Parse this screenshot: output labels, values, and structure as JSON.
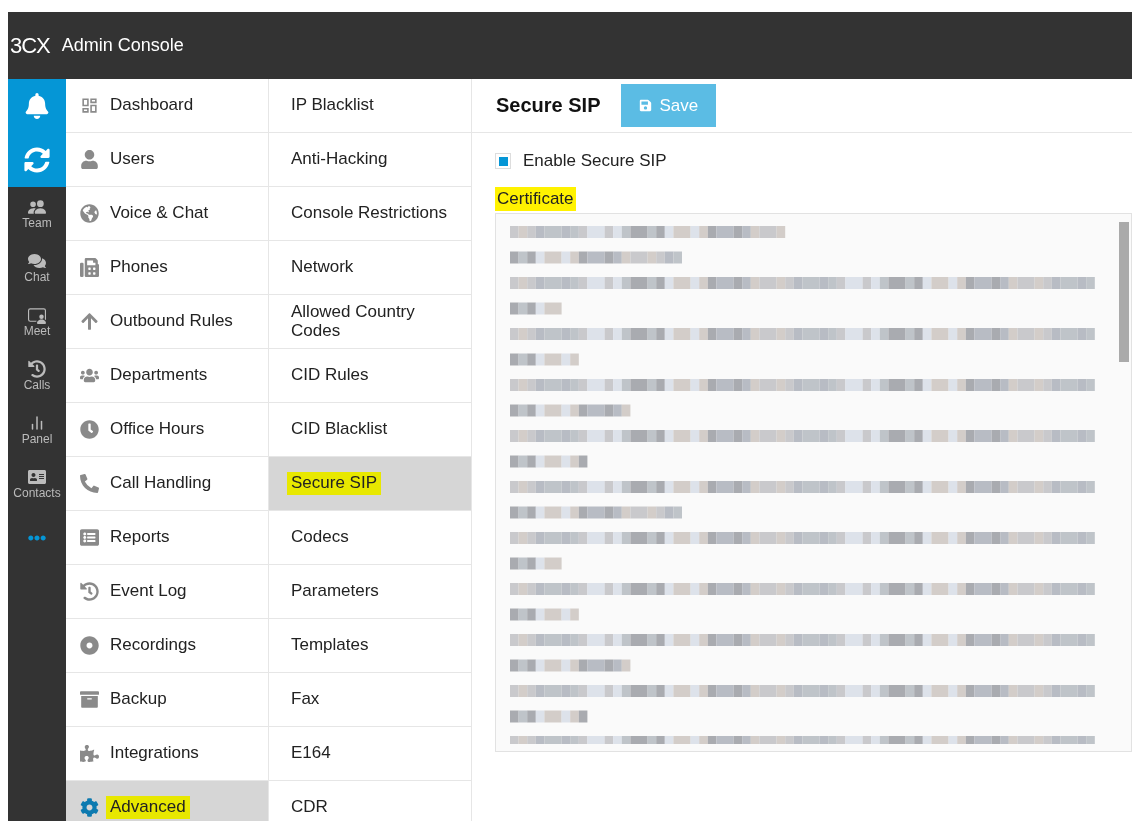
{
  "header": {
    "logo": "3CX",
    "title": "Admin Console"
  },
  "rail": [
    {
      "active": true
    },
    {
      "active": true
    },
    {
      "label": "Team",
      "active": false
    },
    {
      "label": "Chat",
      "active": false
    },
    {
      "label": "Meet",
      "active": false
    },
    {
      "label": "Calls",
      "active": false
    },
    {
      "label": "Panel",
      "active": false
    },
    {
      "label": "Contacts",
      "active": false
    },
    {
      "active": false
    }
  ],
  "nav": [
    {
      "label": "Dashboard",
      "selected": false,
      "highlighted": false
    },
    {
      "label": "Users",
      "selected": false,
      "highlighted": false
    },
    {
      "label": "Voice & Chat",
      "selected": false,
      "highlighted": false
    },
    {
      "label": "Phones",
      "selected": false,
      "highlighted": false
    },
    {
      "label": "Outbound Rules",
      "selected": false,
      "highlighted": false
    },
    {
      "label": "Departments",
      "selected": false,
      "highlighted": false
    },
    {
      "label": "Office Hours",
      "selected": false,
      "highlighted": false
    },
    {
      "label": "Call Handling",
      "selected": false,
      "highlighted": false
    },
    {
      "label": "Reports",
      "selected": false,
      "highlighted": false
    },
    {
      "label": "Event Log",
      "selected": false,
      "highlighted": false
    },
    {
      "label": "Recordings",
      "selected": false,
      "highlighted": false
    },
    {
      "label": "Backup",
      "selected": false,
      "highlighted": false
    },
    {
      "label": "Integrations",
      "selected": false,
      "highlighted": false
    },
    {
      "label": "Advanced",
      "selected": true,
      "highlighted": true
    }
  ],
  "submenu": [
    {
      "label": "IP Blacklist",
      "selected": false,
      "highlighted": false
    },
    {
      "label": "Anti-Hacking",
      "selected": false,
      "highlighted": false
    },
    {
      "label": "Console Restrictions",
      "selected": false,
      "highlighted": false
    },
    {
      "label": "Network",
      "selected": false,
      "highlighted": false
    },
    {
      "label": "Allowed Country Codes",
      "selected": false,
      "highlighted": false
    },
    {
      "label": "CID Rules",
      "selected": false,
      "highlighted": false
    },
    {
      "label": "CID Blacklist",
      "selected": false,
      "highlighted": false
    },
    {
      "label": "Secure SIP",
      "selected": true,
      "highlighted": true
    },
    {
      "label": "Codecs",
      "selected": false,
      "highlighted": false
    },
    {
      "label": "Parameters",
      "selected": false,
      "highlighted": false
    },
    {
      "label": "Templates",
      "selected": false,
      "highlighted": false
    },
    {
      "label": "Fax",
      "selected": false,
      "highlighted": false
    },
    {
      "label": "E164",
      "selected": false,
      "highlighted": false
    },
    {
      "label": "CDR",
      "selected": false,
      "highlighted": false
    }
  ],
  "content": {
    "title": "Secure SIP",
    "save_button": "Save",
    "enable": {
      "label": "Enable Secure SIP",
      "checked": true
    },
    "certificate": {
      "label": "Certificate",
      "highlighted": true
    }
  }
}
